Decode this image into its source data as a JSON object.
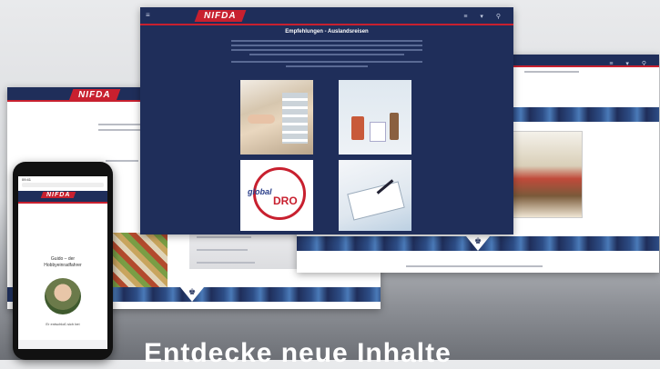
{
  "brand": {
    "logo_text": "NIFDA"
  },
  "main_screen": {
    "title": "Empfehlungen - Auslandsreisen",
    "tiles": [
      {
        "name": "pharmacy-shelf-photo"
      },
      {
        "name": "medicine-bottles-photo"
      },
      {
        "name": "globaldro-logo",
        "text_global": "global",
        "text_dro": "DRO"
      },
      {
        "name": "clipboard-writing-photo"
      }
    ]
  },
  "phone": {
    "time": "09:41",
    "heading_line1": "Guido – der",
    "heading_line2": "Hobbyeinradfahrer",
    "caption": "Er entschloß sich bei"
  },
  "headline": "Entdecke neue Inhalte"
}
